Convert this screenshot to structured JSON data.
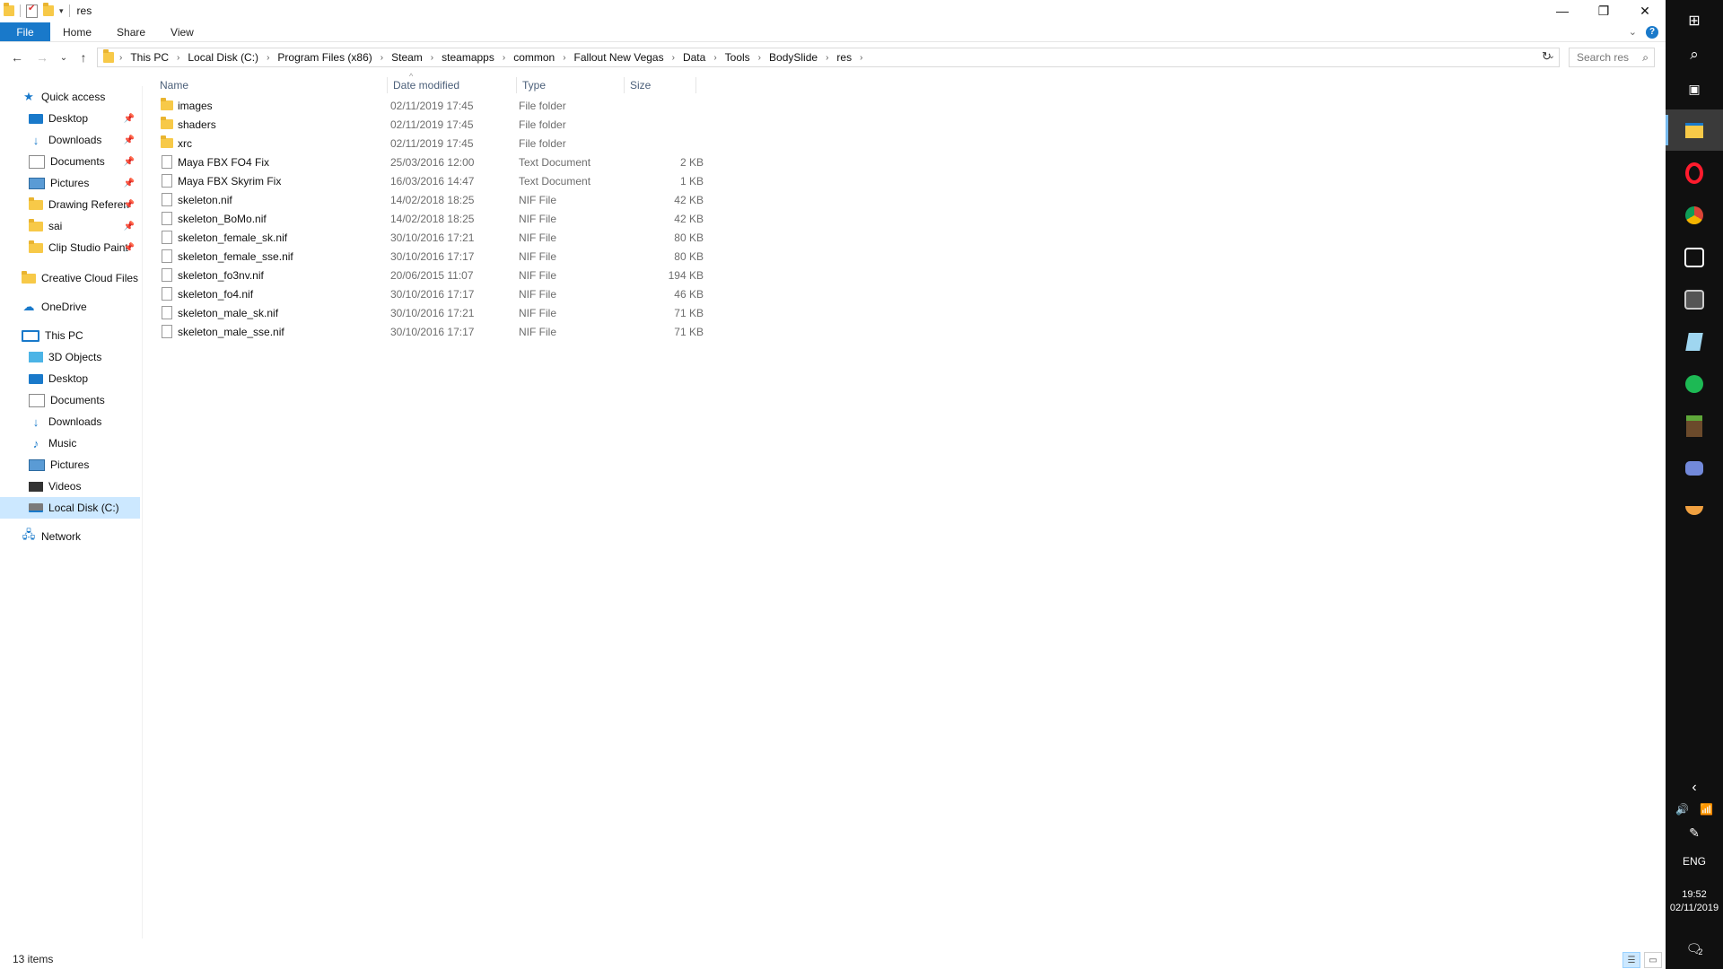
{
  "window": {
    "title": "res",
    "controls": {
      "minimize": "—",
      "maximize": "❐",
      "close": "✕"
    }
  },
  "ribbon": {
    "tabs": [
      "File",
      "Home",
      "Share",
      "View"
    ],
    "expand": "⌄",
    "help": "?"
  },
  "nav": {
    "back": "←",
    "forward": "→",
    "recent": "⌄",
    "up": "↑",
    "breadcrumbs": [
      "This PC",
      "Local Disk (C:)",
      "Program Files (x86)",
      "Steam",
      "steamapps",
      "common",
      "Fallout New Vegas",
      "Data",
      "Tools",
      "BodySlide",
      "res"
    ],
    "search_placeholder": "Search res"
  },
  "sidebar": {
    "quick_access": "Quick access",
    "quick_items": [
      {
        "label": "Desktop",
        "icon": "desktop-icon"
      },
      {
        "label": "Downloads",
        "icon": "downloads-icon"
      },
      {
        "label": "Documents",
        "icon": "documents-icon"
      },
      {
        "label": "Pictures",
        "icon": "pictures-icon"
      },
      {
        "label": "Drawing Referen",
        "icon": "folder-icon"
      },
      {
        "label": "sai",
        "icon": "folder-icon"
      },
      {
        "label": "Clip Studio Paint",
        "icon": "folder-icon"
      }
    ],
    "creative_cloud": "Creative Cloud Files",
    "onedrive": "OneDrive",
    "this_pc": "This PC",
    "pc_items": [
      {
        "label": "3D Objects",
        "icon": "3d-objects-icon"
      },
      {
        "label": "Desktop",
        "icon": "desktop-icon"
      },
      {
        "label": "Documents",
        "icon": "documents-icon"
      },
      {
        "label": "Downloads",
        "icon": "downloads-icon"
      },
      {
        "label": "Music",
        "icon": "music-icon"
      },
      {
        "label": "Pictures",
        "icon": "pictures-icon"
      },
      {
        "label": "Videos",
        "icon": "videos-icon"
      },
      {
        "label": "Local Disk (C:)",
        "icon": "disk-icon"
      }
    ],
    "network": "Network"
  },
  "columns": {
    "name": "Name",
    "date": "Date modified",
    "type": "Type",
    "size": "Size"
  },
  "files": [
    {
      "name": "images",
      "date": "02/11/2019 17:45",
      "type": "File folder",
      "size": "",
      "kind": "folder"
    },
    {
      "name": "shaders",
      "date": "02/11/2019 17:45",
      "type": "File folder",
      "size": "",
      "kind": "folder"
    },
    {
      "name": "xrc",
      "date": "02/11/2019 17:45",
      "type": "File folder",
      "size": "",
      "kind": "folder"
    },
    {
      "name": "Maya FBX FO4 Fix",
      "date": "25/03/2016 12:00",
      "type": "Text Document",
      "size": "2 KB",
      "kind": "file"
    },
    {
      "name": "Maya FBX Skyrim Fix",
      "date": "16/03/2016 14:47",
      "type": "Text Document",
      "size": "1 KB",
      "kind": "file"
    },
    {
      "name": "skeleton.nif",
      "date": "14/02/2018 18:25",
      "type": "NIF File",
      "size": "42 KB",
      "kind": "file"
    },
    {
      "name": "skeleton_BoMo.nif",
      "date": "14/02/2018 18:25",
      "type": "NIF File",
      "size": "42 KB",
      "kind": "file"
    },
    {
      "name": "skeleton_female_sk.nif",
      "date": "30/10/2016 17:21",
      "type": "NIF File",
      "size": "80 KB",
      "kind": "file"
    },
    {
      "name": "skeleton_female_sse.nif",
      "date": "30/10/2016 17:17",
      "type": "NIF File",
      "size": "80 KB",
      "kind": "file"
    },
    {
      "name": "skeleton_fo3nv.nif",
      "date": "20/06/2015 11:07",
      "type": "NIF File",
      "size": "194 KB",
      "kind": "file"
    },
    {
      "name": "skeleton_fo4.nif",
      "date": "30/10/2016 17:17",
      "type": "NIF File",
      "size": "46 KB",
      "kind": "file"
    },
    {
      "name": "skeleton_male_sk.nif",
      "date": "30/10/2016 17:21",
      "type": "NIF File",
      "size": "71 KB",
      "kind": "file"
    },
    {
      "name": "skeleton_male_sse.nif",
      "date": "30/10/2016 17:17",
      "type": "NIF File",
      "size": "71 KB",
      "kind": "file"
    }
  ],
  "status": {
    "count": "13 items"
  },
  "taskbar": {
    "apps": [
      "start-icon",
      "search-icon",
      "task-view-icon",
      "file-explorer-icon",
      "opera-icon",
      "chrome-icon",
      "app-icon",
      "app-icon",
      "app-icon",
      "spotify-icon",
      "minecraft-icon",
      "discord-icon",
      "app-icon"
    ],
    "tray_expand": "‹",
    "language": "ENG",
    "time": "19:52",
    "date": "02/11/2019",
    "notifications": "2"
  }
}
